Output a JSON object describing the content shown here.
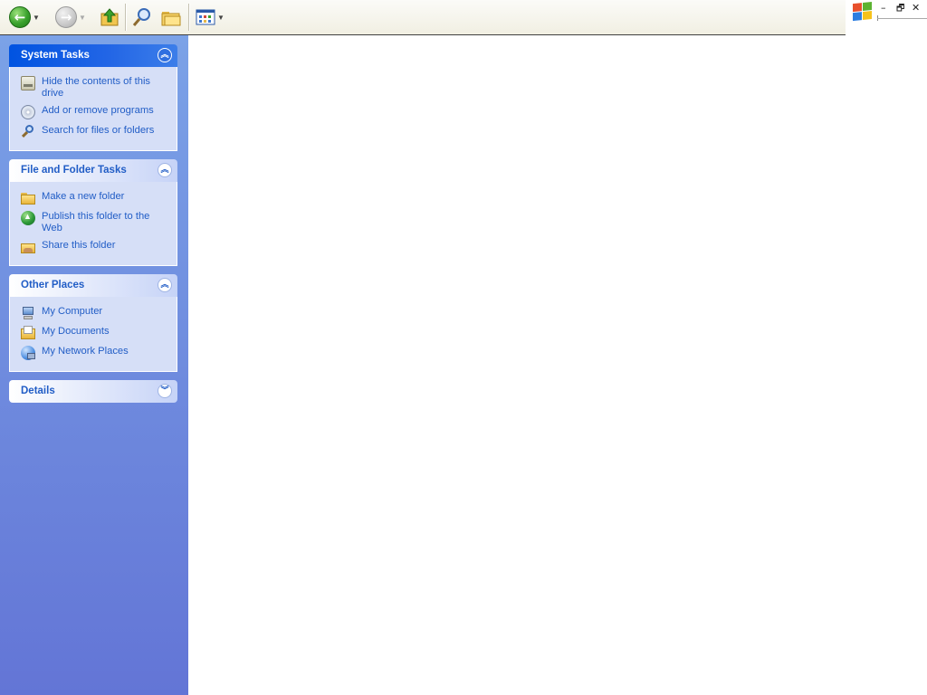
{
  "toolbar": {
    "back_label": "Back",
    "forward_label": "Forward",
    "buttons": [
      "back",
      "forward",
      "up",
      "search",
      "folders",
      "views"
    ]
  },
  "window": {
    "minimize_glyph": "–",
    "restore_glyph": "🗗",
    "close_glyph": "✕"
  },
  "colors": {
    "taskpane_top": "#7ba2e7",
    "taskpane_bottom": "#6375d6",
    "special_header": "#0053e1",
    "link_text": "#215dc6",
    "panel_body": "#d6dff7"
  },
  "panels": {
    "system_tasks": {
      "title": "System Tasks",
      "items": [
        {
          "label": "Hide the contents of this drive",
          "icon": "drive-icon"
        },
        {
          "label": "Add or remove programs",
          "icon": "cd-icon"
        },
        {
          "label": "Search for files or folders",
          "icon": "search-icon"
        }
      ]
    },
    "file_folder_tasks": {
      "title": "File and Folder Tasks",
      "items": [
        {
          "label": "Make a new folder",
          "icon": "new-folder-icon"
        },
        {
          "label": "Publish this folder to the Web",
          "icon": "publish-web-icon"
        },
        {
          "label": "Share this folder",
          "icon": "share-folder-icon"
        }
      ]
    },
    "other_places": {
      "title": "Other Places",
      "items": [
        {
          "label": "My Computer",
          "icon": "my-computer-icon"
        },
        {
          "label": "My Documents",
          "icon": "my-documents-icon"
        },
        {
          "label": "My Network Places",
          "icon": "network-places-icon"
        }
      ]
    },
    "details": {
      "title": "Details"
    }
  }
}
